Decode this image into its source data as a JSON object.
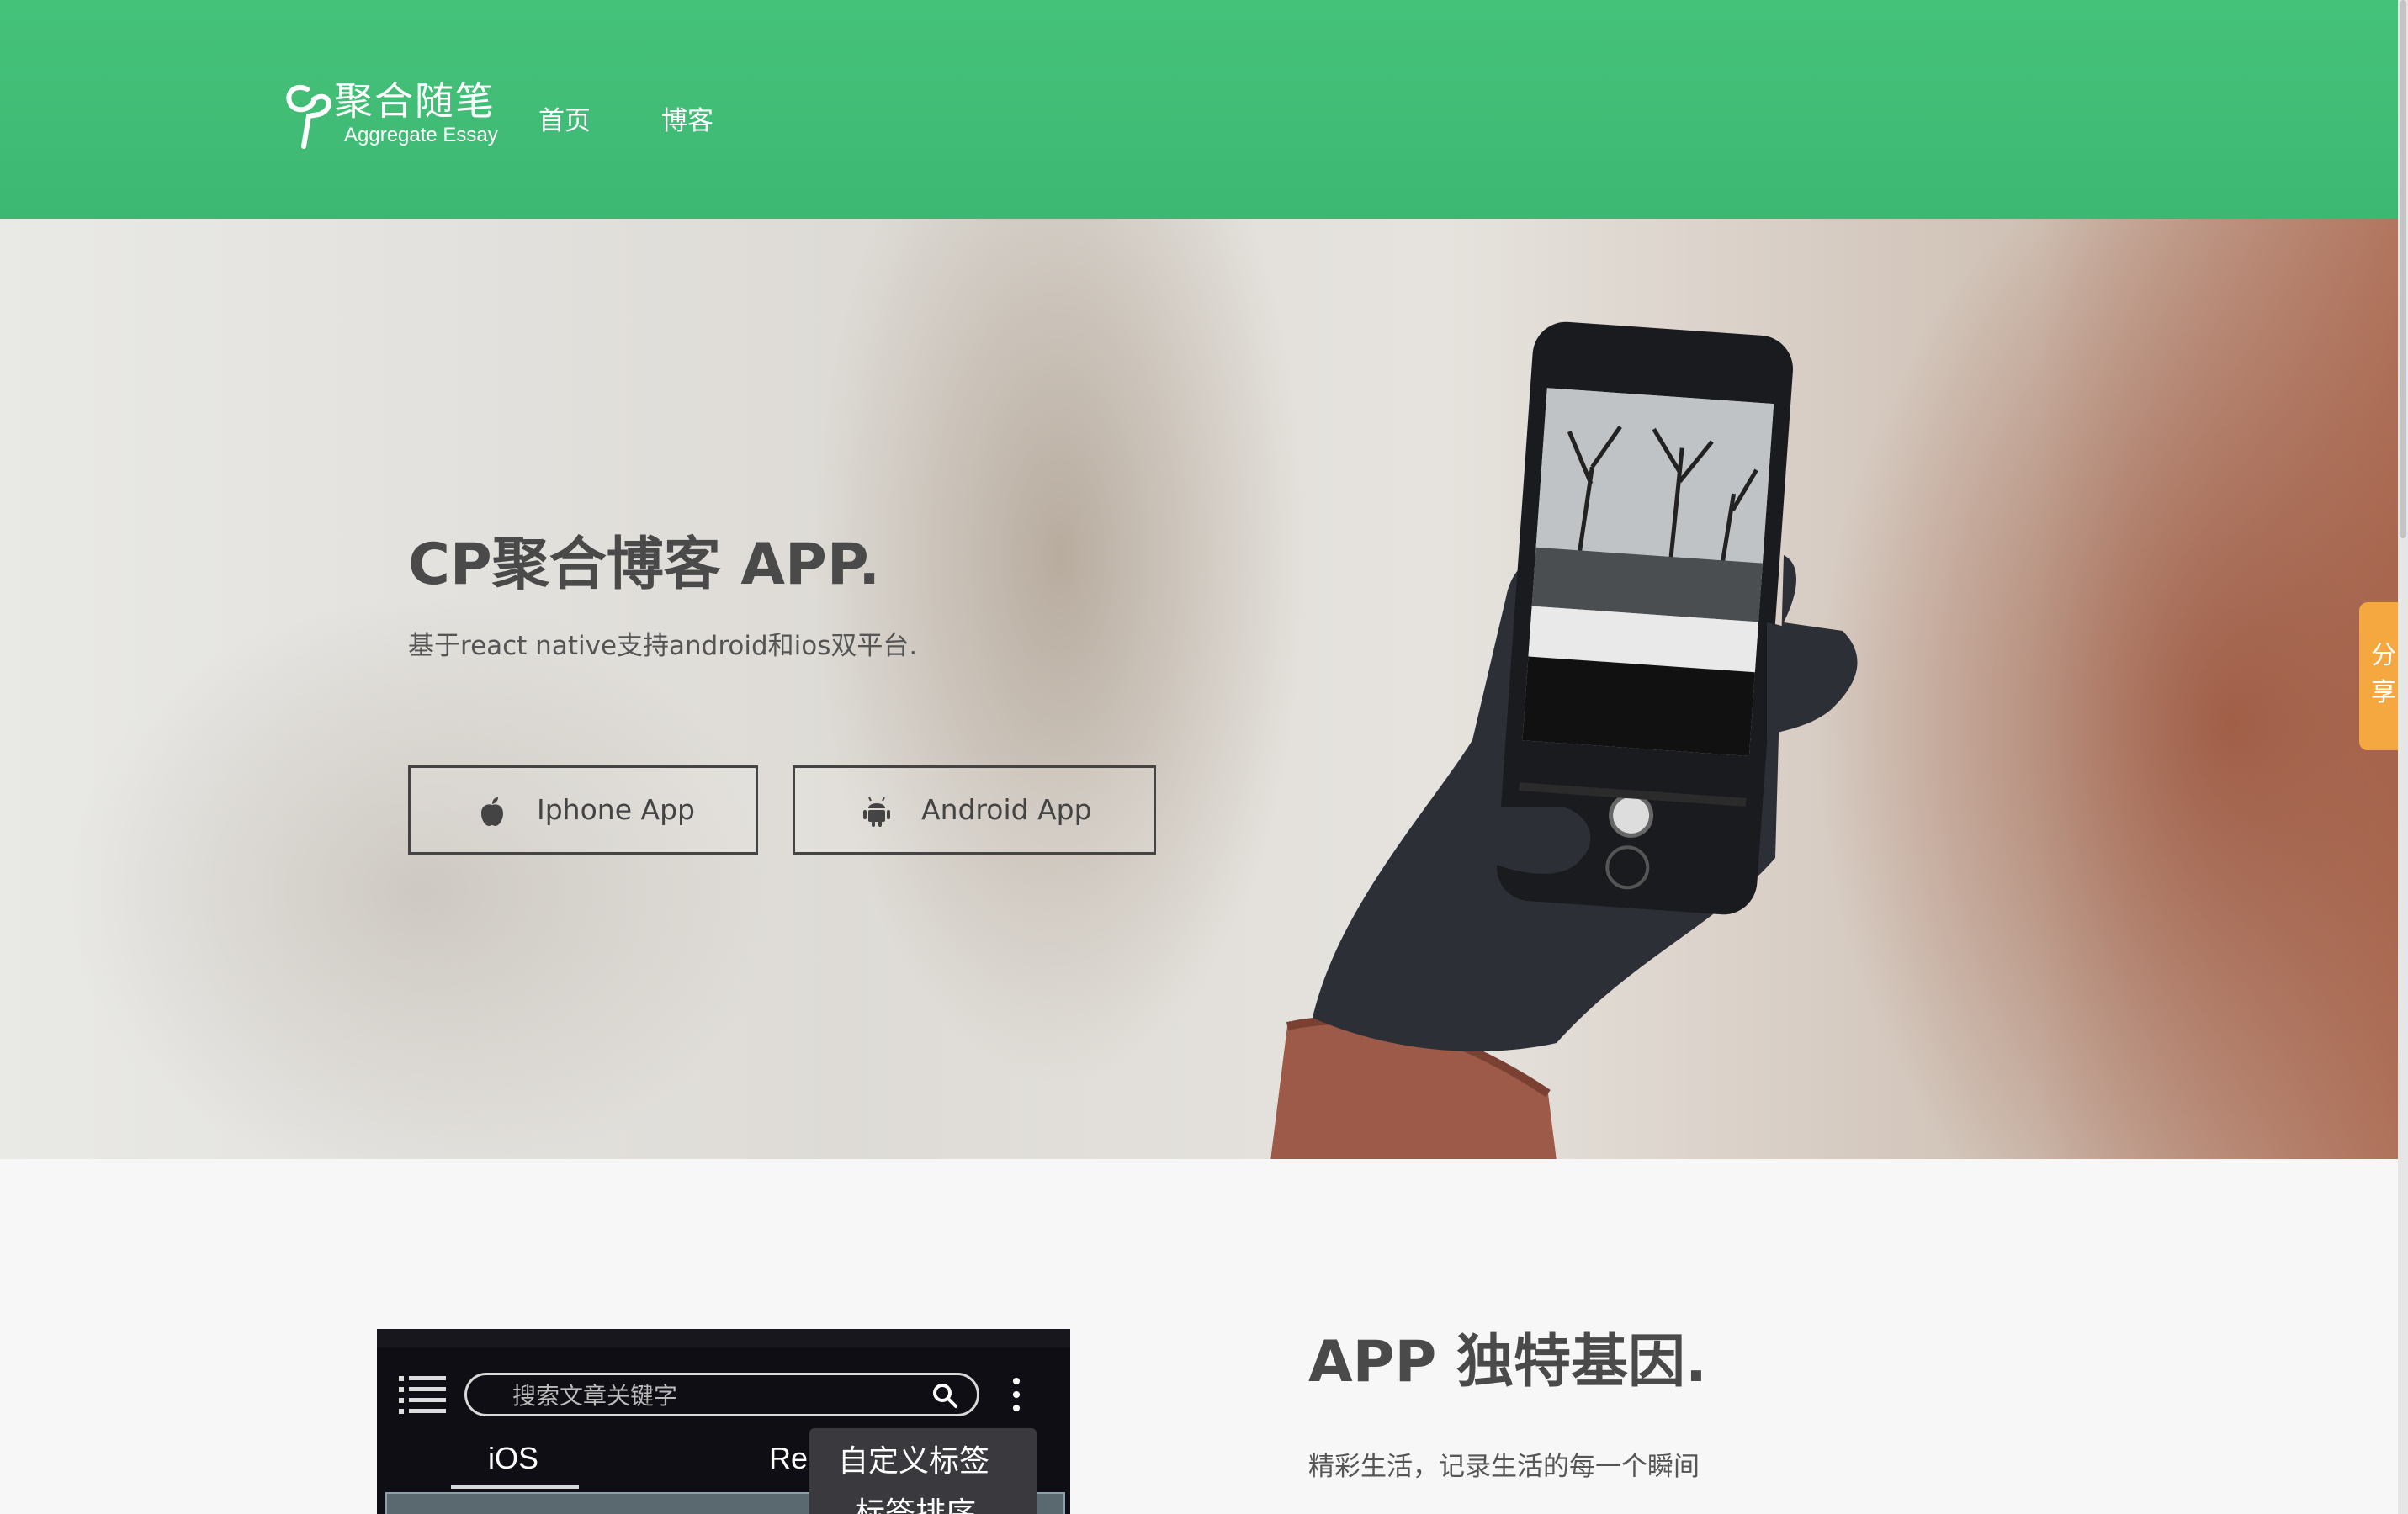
{
  "header": {
    "logo_cn": "聚合随笔",
    "logo_en": "Aggregate Essay",
    "nav": [
      {
        "label": "首页"
      },
      {
        "label": "博客"
      }
    ],
    "background_color": "#45c27a"
  },
  "hero": {
    "title": "CP聚合博客 APP.",
    "subtitle": "基于react native支持android和ios双平台.",
    "buttons": [
      {
        "label": "Iphone App",
        "icon": "apple-icon"
      },
      {
        "label": "Android App",
        "icon": "android-icon"
      }
    ]
  },
  "share": {
    "label": "分享",
    "color": "#f5a740"
  },
  "feature": {
    "title": "APP 独特基因.",
    "description": "精彩生活，记录生活的每一个瞬间",
    "screenshot": {
      "search_placeholder": "搜索文章关键字",
      "tab_ios": "iOS",
      "tab_react": "Rea",
      "menu_item_1": "自定义标签",
      "menu_item_2": "标签排序"
    }
  }
}
